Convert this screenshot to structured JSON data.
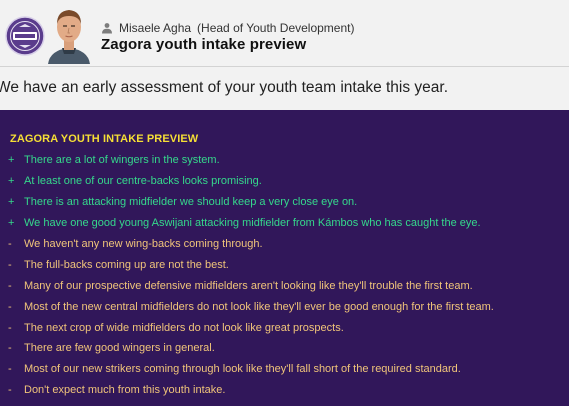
{
  "header": {
    "club_badge_icon": "club-crest-icon",
    "sender_icon": "person-icon",
    "sender_name": "Misaele Agha",
    "sender_role": "(Head of Youth Development)",
    "title": "Zagora youth intake preview"
  },
  "intro": "We have an early assessment of your youth team intake this year.",
  "report": {
    "heading": "ZAGORA YOUTH INTAKE PREVIEW",
    "items": [
      {
        "symbol": "+",
        "type": "pos",
        "text": "There are a lot of wingers in the system."
      },
      {
        "symbol": "+",
        "type": "pos",
        "text": "At least one of our centre-backs looks promising."
      },
      {
        "symbol": "+",
        "type": "pos",
        "text": "There is an attacking midfielder we should keep a very close eye on."
      },
      {
        "symbol": "+",
        "type": "pos",
        "text": "We have one good young Aswijani attacking midfielder from Kámbos who has caught the eye."
      },
      {
        "symbol": "-",
        "type": "neg",
        "text": "We haven't any new wing-backs coming through."
      },
      {
        "symbol": "-",
        "type": "neg",
        "text": "The full-backs coming up are not the best."
      },
      {
        "symbol": "-",
        "type": "neg",
        "text": "Many of our prospective defensive midfielders aren't looking like they'll trouble the first team."
      },
      {
        "symbol": "-",
        "type": "neg",
        "text": "Most of the new central midfielders do not look like they'll ever be good enough for the first team."
      },
      {
        "symbol": "-",
        "type": "neg",
        "text": "The next crop of wide midfielders do not look like great prospects."
      },
      {
        "symbol": "-",
        "type": "neg",
        "text": "There are few good wingers in general."
      },
      {
        "symbol": "-",
        "type": "neg",
        "text": "Most of our new strikers coming through look like they'll fall short of the required standard."
      },
      {
        "symbol": "-",
        "type": "neg",
        "text": "Don't expect much from this youth intake."
      }
    ]
  },
  "colors": {
    "panel_bg": "#31175a",
    "heading": "#f6df35",
    "positive": "#35d88c",
    "negative": "#f0c47a"
  }
}
